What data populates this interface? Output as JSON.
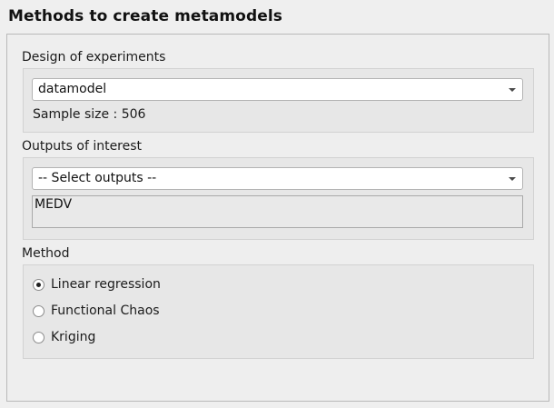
{
  "page": {
    "title": "Methods to create metamodels"
  },
  "design_of_experiments": {
    "label": "Design of experiments",
    "selected": "datamodel",
    "sample_size_text": "Sample size : 506"
  },
  "outputs_of_interest": {
    "label": "Outputs of interest",
    "placeholder": "-- Select outputs --",
    "selected_outputs": [
      "MEDV"
    ]
  },
  "method": {
    "label": "Method",
    "options": [
      {
        "label": "Linear regression",
        "checked": true
      },
      {
        "label": "Functional Chaos",
        "checked": false
      },
      {
        "label": "Kriging",
        "checked": false
      }
    ]
  },
  "icons": {
    "combo_arrow": "chevron-down-icon"
  },
  "colors": {
    "background": "#efefef",
    "group_background": "#e7e7e7",
    "border": "#b9b9b9",
    "text": "#1b1b1b"
  }
}
